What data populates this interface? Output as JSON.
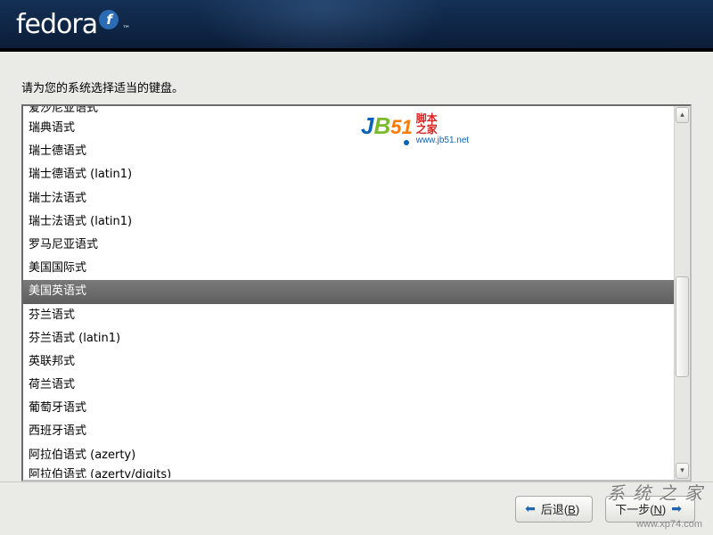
{
  "brand": {
    "name": "fedora",
    "tm": "™"
  },
  "prompt": "请为您的系统选择适当的键盘。",
  "keyboard_list": {
    "cut_top_item": "爱沙尼亚语式",
    "items": [
      "瑞典语式",
      "瑞士德语式",
      "瑞士德语式 (latin1)",
      "瑞士法语式",
      "瑞士法语式 (latin1)",
      "罗马尼亚语式",
      "美国国际式",
      "美国英语式",
      "芬兰语式",
      "芬兰语式 (latin1)",
      "英联邦式",
      "荷兰语式",
      "葡萄牙语式",
      "西班牙语式",
      "阿拉伯语式 (azerty)"
    ],
    "cut_bot_item": "阿拉伯语式 (azerty/digits)",
    "selected_index": 7
  },
  "watermark_center": {
    "text": "JB51",
    "cn1": "脚本",
    "cn2": "之家",
    "url": "www.jb51.net"
  },
  "footer": {
    "back": "后退(B)",
    "next": "下一步(N)"
  },
  "overlay": {
    "site_cn": "系 统 之 家",
    "site_url": "www.xp74.com"
  }
}
